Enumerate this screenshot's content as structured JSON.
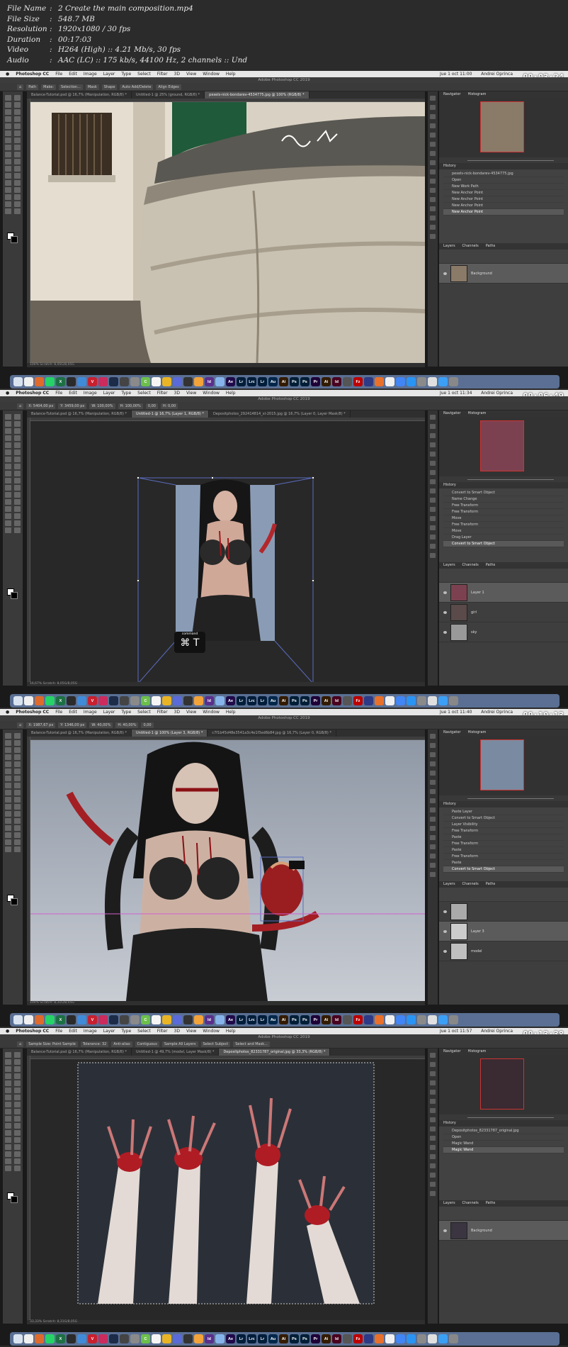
{
  "file_info": [
    {
      "label": "File Name",
      "value": "2 Create the main composition.mp4"
    },
    {
      "label": "File Size",
      "value": "548.7 MB"
    },
    {
      "label": "Resolution",
      "value": "1920x1080 / 30 fps"
    },
    {
      "label": "Duration",
      "value": "00:17:03"
    },
    {
      "label": "Video",
      "value": "H264 (High) :: 4.21 Mb/s, 30 fps"
    },
    {
      "label": "Audio",
      "value": "AAC (LC) :: 175 kb/s, 44100 Hz, 2 channels :: Und"
    }
  ],
  "menu": {
    "app": "Photoshop CC",
    "items": [
      "File",
      "Edit",
      "Image",
      "Layer",
      "Type",
      "Select",
      "Filter",
      "3D",
      "View",
      "Window",
      "Help"
    ]
  },
  "app_title": "Adobe Photoshop CC 2019",
  "user": "Andrei Oprinca",
  "frames": [
    {
      "timestamp": "00:03:24",
      "clock": "Jue 1 oct 11:00",
      "tabs": [
        "Balance-Tutorial.psd @ 16,7% (Manipulation, RGB/8) *",
        "Untitled-1 @ 25% (ground, RGB/8) *",
        "pexels-nick-bondarev-4534775.jpg @ 100% (RGB/8) *"
      ],
      "active_tab": 2,
      "options": [
        "Path",
        "Make:",
        "Selection...",
        "Mask",
        "Shape",
        "Auto Add/Delete",
        "Align Edges"
      ],
      "status": "100%   Scratch: 8,05G/8,05G",
      "history": [
        "pexels-nick-bondarev-4534775.jpg",
        "Open",
        "New Work Path",
        "New Anchor Point",
        "New Anchor Point",
        "New Anchor Point",
        "New Anchor Point"
      ],
      "history_selected": 6,
      "layers": [
        "Background"
      ],
      "layer_selected": 0
    },
    {
      "timestamp": "00:06:49",
      "clock": "Jue 1 oct 11:34",
      "tabs": [
        "Balance-Tutorial.psd @ 16,7% (Manipulation, RGB/8) *",
        "Untitled-1 @ 16,7% (Layer 1, RGB/8) *",
        "Depositphotos_292414814_xl-2015.jpg @ 16,7% (Layer 0, Layer Mask/8) *"
      ],
      "active_tab": 1,
      "options": [
        "X: 5404,00 px",
        "Y: 3459,00 px",
        "W: 100,00%",
        "H: 100,00%",
        "0,00",
        "H: 0,00"
      ],
      "status": "16,67%   Scratch: 8,05G/8,05G",
      "overlay_key": "⌘ T",
      "overlay_caption": "command",
      "history": [
        "Convert to Smart Object",
        "Name Change",
        "Free Transform",
        "Free Transform",
        "Move",
        "Free Transform",
        "Move",
        "Drag Layer",
        "Convert to Smart Object"
      ],
      "history_selected": 8,
      "layers": [
        "Layer 1",
        "girl",
        "sky"
      ],
      "layer_selected": 0
    },
    {
      "timestamp": "00:10:13",
      "clock": "Jue 1 oct 11:40",
      "tabs": [
        "Balance-Tutorial.psd @ 16,7% (Manipulation, RGB/8) *",
        "Untitled-1 @ 100% (Layer 3, RGB/8) *",
        "c7f1b45d48e3541a3c4e1f3ed6b84.jpg @ 16,7% (Layer 0, RGB/8) *"
      ],
      "active_tab": 1,
      "options": [
        "X: 1987,67 px",
        "Y: 1346,00 px",
        "W: 40,00%",
        "H: 40,00%",
        "0,00"
      ],
      "status": "100%   Scratch: 8,31G/8,05G",
      "history": [
        "Paste Layer",
        "Convert to Smart Object",
        "Layer Visibility",
        "Free Transform",
        "Paste",
        "Free Transform",
        "Paste",
        "Free Transform",
        "Paste",
        "Convert to Smart Object"
      ],
      "history_selected": 9,
      "layers": [
        "",
        "Layer 3",
        "model"
      ],
      "layer_selected": 1
    },
    {
      "timestamp": "00:13:38",
      "clock": "Jue 1 oct 11:57",
      "tabs": [
        "Balance-Tutorial.psd @ 16,7% (Manipulation, RGB/8) *",
        "Untitled-1 @ 49,7% (model, Layer Mask/8) *",
        "Depositphotos_82331787_original.jpg @ 33,3% (RGB/8) *"
      ],
      "active_tab": 2,
      "options": [
        "Sample Size: Point Sample",
        "Tolerance: 32",
        "Anti-alias",
        "Contiguous",
        "Sample All Layers",
        "Select Subject",
        "Select and Mask..."
      ],
      "status": "33,33%   Scratch: 8,31G/8,05G",
      "history": [
        "Depositphotos_82331787_original.jpg",
        "Open",
        "Magic Wand",
        "Magic Wand"
      ],
      "history_selected": 3,
      "layers": [
        "Background"
      ],
      "layer_selected": 0
    }
  ],
  "panel_tabs": {
    "nav": [
      "Navigator",
      "Histogram"
    ],
    "history": [
      "History"
    ],
    "layers": [
      "Layers",
      "Channels",
      "Paths"
    ]
  },
  "dock_apps": [
    {
      "label": "",
      "color": "#d9e3ef"
    },
    {
      "label": "",
      "color": "#f0f0f0"
    },
    {
      "label": "",
      "color": "#e06a2b"
    },
    {
      "label": "",
      "color": "#25d366"
    },
    {
      "label": "X",
      "color": "#1d7044"
    },
    {
      "label": "",
      "color": "#2b2b2b"
    },
    {
      "label": "",
      "color": "#3f8bd8"
    },
    {
      "label": "V",
      "color": "#c8202f"
    },
    {
      "label": "",
      "color": "#cc2b5e"
    },
    {
      "label": "",
      "color": "#1c2b48"
    },
    {
      "label": "",
      "color": "#444"
    },
    {
      "label": "",
      "color": "#8a8a8a"
    },
    {
      "label": "C",
      "color": "#6cc04a"
    },
    {
      "label": "",
      "color": "#f5f5f5"
    },
    {
      "label": "",
      "color": "#e9b425"
    },
    {
      "label": "",
      "color": "#5a6ad8"
    },
    {
      "label": "",
      "color": "#333"
    },
    {
      "label": "",
      "color": "#f2a33a"
    },
    {
      "label": "Id",
      "color": "#5a2f8c"
    },
    {
      "label": "",
      "color": "#86b4ea"
    },
    {
      "label": "Ae",
      "color": "#1f0a4a"
    },
    {
      "label": "Lr",
      "color": "#001d3a"
    },
    {
      "label": "Lrc",
      "color": "#001d3a"
    },
    {
      "label": "Lr",
      "color": "#001d3a"
    },
    {
      "label": "Au",
      "color": "#00274a"
    },
    {
      "label": "Ai",
      "color": "#331b00"
    },
    {
      "label": "Ps",
      "color": "#001e36"
    },
    {
      "label": "Ps",
      "color": "#001e36"
    },
    {
      "label": "Pr",
      "color": "#1e0037"
    },
    {
      "label": "Ai",
      "color": "#331b00"
    },
    {
      "label": "Id",
      "color": "#49021f"
    },
    {
      "label": "",
      "color": "#555"
    },
    {
      "label": "Fz",
      "color": "#b00"
    },
    {
      "label": "",
      "color": "#2d3a85"
    },
    {
      "label": "",
      "color": "#e8702a"
    },
    {
      "label": "",
      "color": "#f0f0f0"
    },
    {
      "label": "",
      "color": "#4285f4"
    },
    {
      "label": "",
      "color": "#2a94f4"
    },
    {
      "label": "",
      "color": "#8a8a8a"
    },
    {
      "label": "",
      "color": "#e0e0e0"
    },
    {
      "label": "",
      "color": "#3b9ff5"
    },
    {
      "label": "",
      "color": "#888"
    }
  ]
}
